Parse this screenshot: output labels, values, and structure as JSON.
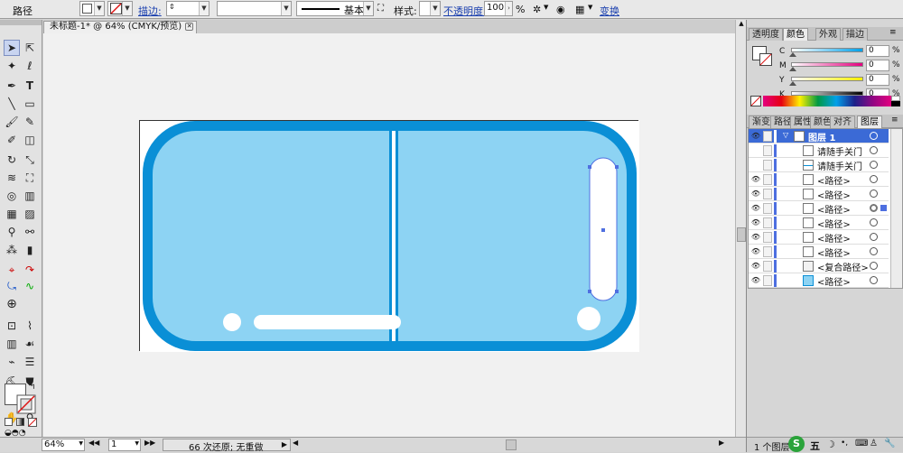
{
  "control_bar": {
    "object_type": "路径",
    "stroke_label": "描边:",
    "stroke_value": "",
    "stroke_profile_label": "基本",
    "style_label": "样式:",
    "opacity_label": "不透明度:",
    "opacity_value": "100",
    "percent": "%",
    "transform_label": "变换"
  },
  "document_tab": {
    "title": "未标题-1* @ 64% (CMYK/预览)"
  },
  "statusbar": {
    "zoom": "64%",
    "artboard": "1",
    "status_text": "66 次还原; 无重做"
  },
  "color_panel": {
    "tabs": [
      "透明度",
      "颜色",
      "外观",
      "描边"
    ],
    "active_tab": "颜色",
    "channels": [
      {
        "label": "C",
        "value": "0",
        "unit": "%",
        "colors": [
          "#ffffff",
          "#00a0e9"
        ]
      },
      {
        "label": "M",
        "value": "0",
        "unit": "%",
        "colors": [
          "#ffffff",
          "#e4007f"
        ]
      },
      {
        "label": "Y",
        "value": "0",
        "unit": "%",
        "colors": [
          "#ffffff",
          "#fff100"
        ]
      },
      {
        "label": "K",
        "value": "0",
        "unit": "%",
        "colors": [
          "#ffffff",
          "#000000"
        ]
      }
    ]
  },
  "layers_panel": {
    "tabs": [
      "渐变",
      "路径",
      "属性",
      "颜色",
      "对齐",
      "图层"
    ],
    "active_tab": "图层",
    "rows": [
      {
        "name": "图层 1",
        "selected": true
      },
      {
        "name": "请随手关门"
      },
      {
        "name": "请随手关门"
      },
      {
        "name": "<路径>"
      },
      {
        "name": "<路径>"
      },
      {
        "name": "<路径>"
      },
      {
        "name": "<路径>"
      },
      {
        "name": "<路径>"
      },
      {
        "name": "<路径>"
      },
      {
        "name": "<复合路径>"
      },
      {
        "name": "<路径>"
      }
    ],
    "footer": "1 个图层"
  },
  "taskbar": {
    "ime_label": "五"
  },
  "colors": {
    "artwork_border": "#0a8fd6",
    "artwork_fill": "#8dd3f3",
    "selection": "#4f6fe0"
  }
}
